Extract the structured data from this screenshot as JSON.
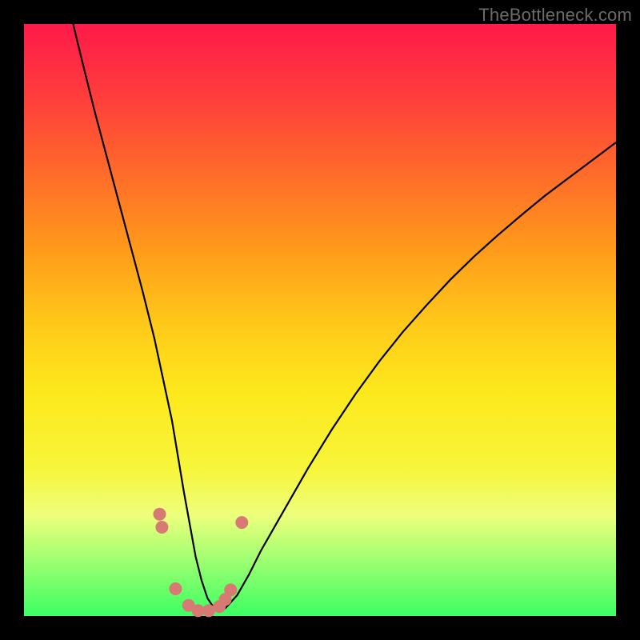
{
  "watermark": "TheBottleneck.com",
  "chart_data": {
    "type": "line",
    "title": "",
    "xlabel": "",
    "ylabel": "",
    "xlim": [
      0,
      100
    ],
    "ylim": [
      0,
      100
    ],
    "grid": false,
    "series": [
      {
        "name": "bottleneck-curve",
        "x_norm": [
          8.3,
          10,
          12,
          14,
          16,
          18,
          20,
          22,
          23.5,
          25,
          26,
          27,
          28,
          29,
          30,
          31,
          32,
          33,
          34,
          36,
          38,
          40,
          44,
          48,
          52,
          56,
          60,
          64,
          68,
          72,
          76,
          80,
          84,
          88,
          92,
          96,
          100
        ],
        "y_norm": [
          100,
          93,
          85,
          77.5,
          70,
          62.5,
          55,
          47,
          40,
          33,
          27,
          21,
          15.5,
          10,
          6,
          3,
          1.5,
          1,
          1.3,
          3.5,
          7,
          11,
          18,
          25,
          31.5,
          37.5,
          43,
          48,
          52.5,
          56.8,
          60.7,
          64.3,
          67.7,
          71,
          74,
          77,
          80
        ]
      }
    ],
    "marker_dots": [
      {
        "x_norm": 22.9,
        "y_norm": 17.2,
        "r": 8
      },
      {
        "x_norm": 23.3,
        "y_norm": 15.0,
        "r": 8
      },
      {
        "x_norm": 25.6,
        "y_norm": 4.6,
        "r": 8
      },
      {
        "x_norm": 27.8,
        "y_norm": 1.8,
        "r": 8
      },
      {
        "x_norm": 29.4,
        "y_norm": 0.9,
        "r": 8
      },
      {
        "x_norm": 31.2,
        "y_norm": 0.9,
        "r": 8
      },
      {
        "x_norm": 33.0,
        "y_norm": 1.6,
        "r": 8
      },
      {
        "x_norm": 34.0,
        "y_norm": 2.8,
        "r": 8
      },
      {
        "x_norm": 34.9,
        "y_norm": 4.4,
        "r": 8
      },
      {
        "x_norm": 36.8,
        "y_norm": 15.8,
        "r": 8
      }
    ],
    "gradient_stops": [
      {
        "pos": 0,
        "color": "#ff1a4a"
      },
      {
        "pos": 12,
        "color": "#ff3c3c"
      },
      {
        "pos": 25,
        "color": "#ff6a2a"
      },
      {
        "pos": 38,
        "color": "#ff9a1a"
      },
      {
        "pos": 50,
        "color": "#ffc719"
      },
      {
        "pos": 62,
        "color": "#fde81c"
      },
      {
        "pos": 75,
        "color": "#f7f53a"
      },
      {
        "pos": 83,
        "color": "#edff7c"
      },
      {
        "pos": 100,
        "color": "#3bff63"
      }
    ]
  }
}
